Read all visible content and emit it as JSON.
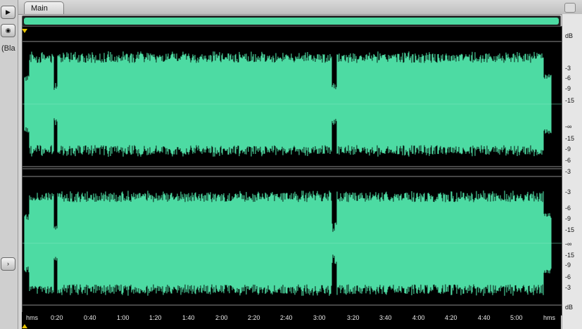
{
  "tabs": [
    {
      "label": "Main"
    }
  ],
  "left_panel": {
    "label": "(Bla"
  },
  "db_scale_top": [
    "dB",
    "-3",
    "-6",
    "-9",
    "-15",
    "-∞",
    "-15",
    "-9",
    "-6",
    "-3"
  ],
  "db_scale_bottom": [
    "-3",
    "-6",
    "-9",
    "-15",
    "-∞",
    "-15",
    "-9",
    "-6",
    "-3",
    "dB"
  ],
  "timeline": [
    "hms",
    "0:20",
    "0:40",
    "1:00",
    "1:20",
    "1:40",
    "2:00",
    "2:20",
    "2:40",
    "3:00",
    "3:20",
    "3:40",
    "4:00",
    "4:20",
    "4:40",
    "5:00",
    "hms"
  ],
  "colors": {
    "waveform": "#4ddba3",
    "background": "#000000",
    "accent": "#4ddba3"
  },
  "icons": {
    "play": "play-icon",
    "visibility": "eye-icon",
    "expand": "expand-arrow-icon",
    "playhead": "playhead-marker-icon"
  }
}
